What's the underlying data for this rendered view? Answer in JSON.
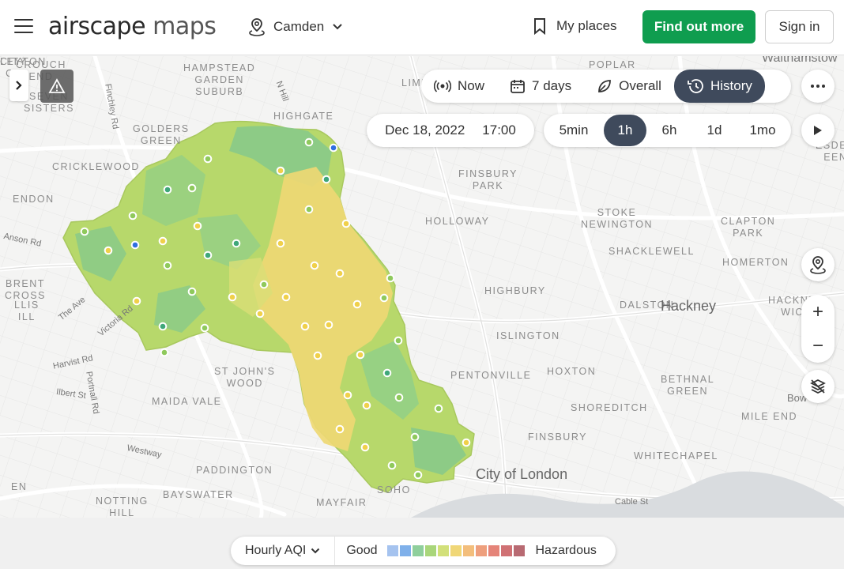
{
  "header": {
    "logo_main": "airscape",
    "logo_sub": "maps",
    "location": "Camden",
    "my_places": "My places",
    "cta": "Find out more",
    "sign_in": "Sign in"
  },
  "modes": [
    {
      "label": "Now",
      "icon": "broadcast-icon"
    },
    {
      "label": "7 days",
      "icon": "calendar-icon"
    },
    {
      "label": "Overall",
      "icon": "leaf-icon"
    },
    {
      "label": "History",
      "icon": "history-icon",
      "active": true
    }
  ],
  "history": {
    "date": "Dec 18, 2022",
    "time": "17:00",
    "intervals": [
      "5min",
      "1h",
      "6h",
      "1d",
      "1mo"
    ],
    "active_interval": "1h"
  },
  "places": [
    {
      "text": "HAMPSTEAD\nGARDEN\nSUBURB"
    },
    {
      "text": "GOLDERS\nGREEN"
    },
    {
      "text": "HIGHGATE"
    },
    {
      "text": "CRICKLEWOOD"
    },
    {
      "text": "FINSBURY\nPARK"
    },
    {
      "text": "HOLLOWAY"
    },
    {
      "text": "STOKE\nNEWINGTON"
    },
    {
      "text": "CLAPTON\nPARK"
    },
    {
      "text": "SHACKLEWELL"
    },
    {
      "text": "HOMERTON"
    },
    {
      "text": "HIGHBURY"
    },
    {
      "text": "DALSTON"
    },
    {
      "text": "HACKNEY\nWICK"
    },
    {
      "text": "ISLINGTON"
    },
    {
      "text": "PENTONVILLE"
    },
    {
      "text": "HOXTON"
    },
    {
      "text": "BETHNAL\nGREEN"
    },
    {
      "text": "ST JOHN'S\nWOOD"
    },
    {
      "text": "MAIDA VALE"
    },
    {
      "text": "SHOREDITCH"
    },
    {
      "text": "MILE END"
    },
    {
      "text": "FINSBURY"
    },
    {
      "text": "WHITECHAPEL"
    },
    {
      "text": "PADDINGTON"
    },
    {
      "text": "BAYSWATER"
    },
    {
      "text": "NOTTING\nHILL"
    },
    {
      "text": "MAYFAIR"
    },
    {
      "text": "SOHO"
    },
    {
      "text": "LIMEHOUSE"
    },
    {
      "text": "POPLAR"
    },
    {
      "text": "CROUCH\nEND"
    },
    {
      "text": "SEVEN\nSISTERS"
    },
    {
      "text": "ENDON"
    },
    {
      "text": "BRENT\nCROSS"
    },
    {
      "text": "LLIS\nILL"
    },
    {
      "text": "EN"
    },
    {
      "text": "ESDEN\nEEN"
    },
    {
      "text": "CITY\nOF"
    },
    {
      "text": "LEYTON"
    }
  ],
  "streets": [
    {
      "text": "Finchley Rd"
    },
    {
      "text": "N Hill"
    },
    {
      "text": "Anson Rd"
    },
    {
      "text": "The Ave"
    },
    {
      "text": "Victoria Rd"
    },
    {
      "text": "Harvist Rd"
    },
    {
      "text": "Ilbert St"
    },
    {
      "text": "Portnall Rd"
    },
    {
      "text": "Westway"
    },
    {
      "text": "Cable St"
    },
    {
      "text": "Walthamstow"
    },
    {
      "text": "Bow"
    }
  ],
  "big_labels": [
    "Hackney",
    "City of London"
  ],
  "legend": {
    "metric": "Hourly AQI",
    "low": "Good",
    "high": "Hazardous",
    "colors": [
      "#a5c3ef",
      "#7fb0ea",
      "#8fcf9c",
      "#a9d67a",
      "#d2e07a",
      "#f0d777",
      "#f3be7c",
      "#ee9f7d",
      "#e58479",
      "#d07174",
      "#b86a72"
    ]
  }
}
